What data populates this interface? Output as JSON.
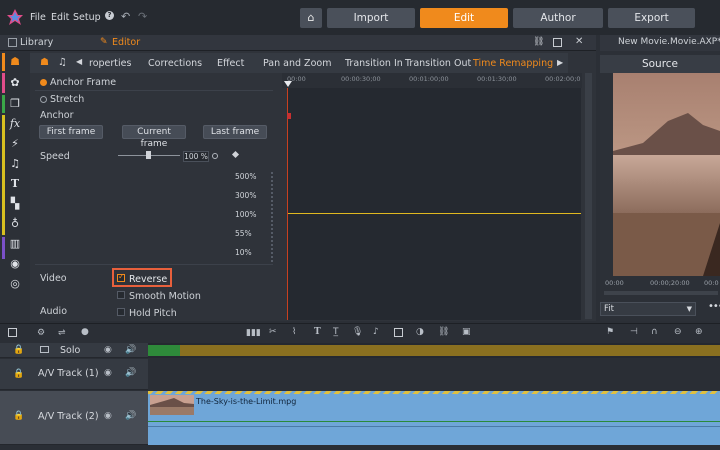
{
  "menubar": {
    "file": "File",
    "edit": "Edit",
    "setup": "Setup",
    "help_icon": "help-icon",
    "undo_icon": "undo-icon",
    "redo_icon": "redo-icon"
  },
  "modes": {
    "home_icon": "home-icon",
    "import": "Import",
    "edit": "Edit",
    "author": "Author",
    "export": "Export",
    "active": "Edit"
  },
  "subbar": {
    "library": "Library",
    "editor": "Editor"
  },
  "project_title": "New Movie.Movie.AXP*",
  "editor_tabs": [
    "roperties",
    "Corrections",
    "Effect",
    "Pan and Zoom",
    "Transition In",
    "Transition Out",
    "Time Remapping"
  ],
  "active_tab": "Time Remapping",
  "timeremap": {
    "anchor_frame": "Anchor Frame",
    "stretch": "Stretch",
    "anchor": "Anchor",
    "first_frame": "First frame",
    "current_frame": "Current frame",
    "last_frame": "Last frame",
    "speed": "Speed",
    "speed_value": "100 %",
    "speed_levels": [
      "500%",
      "300%",
      "100%",
      "55%",
      "10%"
    ],
    "video": "Video",
    "reverse": "Reverse",
    "smooth_motion": "Smooth Motion",
    "audio": "Audio",
    "hold_pitch": "Hold Pitch"
  },
  "ruler_ticks": [
    "00:00",
    "00:00:30;00",
    "00:01:00;00",
    "00:01:30;00",
    "00:02:00;0"
  ],
  "preview": {
    "source": "Source",
    "tc_start": "00:00",
    "tc_mid": "00:00;20:00",
    "tc_end": "00:0",
    "fit": "Fit",
    "more_icon": "more-icon"
  },
  "tracks": [
    {
      "name": "Solo"
    },
    {
      "name": "A/V Track (1)"
    },
    {
      "name": "A/V Track (2)"
    }
  ],
  "clip_name": "The-Sky-is-the-Limit.mpg",
  "colors": {
    "accent": "#f08a1c",
    "reverse_highlight": "#e8603c",
    "speed_line": "#e0b820",
    "clip": "#6fa6d8",
    "solo_bar": "#8a7020"
  }
}
